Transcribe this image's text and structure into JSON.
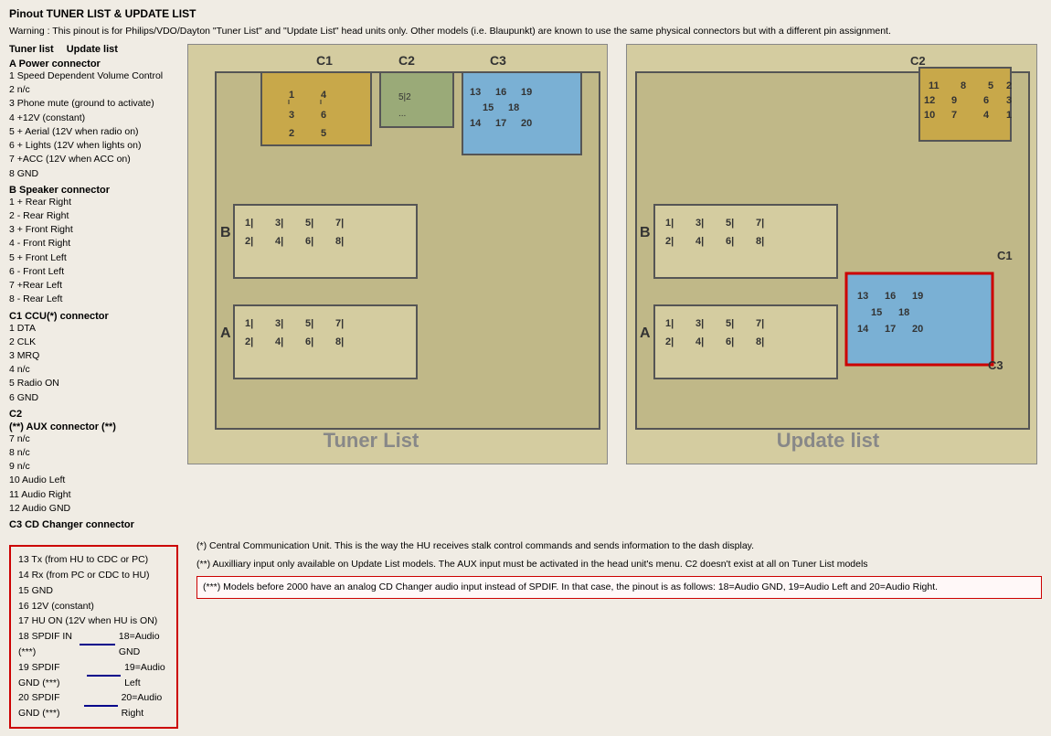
{
  "title": "Pinout TUNER LIST & UPDATE LIST",
  "warning": "Warning : This pinout is for Philips/VDO/Dayton \"Tuner List\" and \"Update List\" head units only. Other models (i.e. Blaupunkt) are known to use the same physical connectors but with a different pin assignment.",
  "list_headers": [
    "Tuner list",
    "Update list"
  ],
  "sections": {
    "A": {
      "label": "A Power connector",
      "items": [
        "1 Speed Dependent Volume Control",
        "2 n/c",
        "3 Phone mute (ground to activate)",
        "4 +12V (constant)",
        "5 + Aerial (12V when radio on)",
        "6 + Lights (12V when lights on)",
        "7 +ACC (12V when ACC on)",
        "8 GND"
      ]
    },
    "B": {
      "label": "B Speaker connector",
      "items": [
        "1 + Rear Right",
        "2 - Rear Right",
        "3 + Front Right",
        "4 - Front Right",
        "5 + Front Left",
        "6 - Front Left",
        "7 +Rear Left",
        "8 - Rear Left"
      ]
    },
    "C1": {
      "label": "C1 CCU(*) connector",
      "items": [
        "1 DTA",
        "2 CLK",
        "3 MRQ",
        "4 n/c",
        "5 Radio ON",
        "6 GND"
      ]
    },
    "C2": {
      "label": "C2",
      "items": []
    },
    "AUX": {
      "label": "(**) AUX connector (**)",
      "items": [
        "7 n/c",
        "8 n/c",
        "9 n/c",
        "10 Audio Left",
        "11 Audio Right",
        "12 Audio GND"
      ]
    },
    "C3": {
      "label": "C3 CD Changer connector",
      "items": []
    }
  },
  "cdc_items": [
    "13 Tx (from HU to CDC or PC)",
    "14 Rx (from PC or CDC to HU)",
    "15 GND",
    "16 12V (constant)",
    "17 HU ON (12V when HU is ON)",
    "18 SPDIF IN (***)",
    "19 SPDIF GND (***)",
    "20 SPDIF GND (***)"
  ],
  "audio_lines": [
    {
      "left": "18 SPDIF IN (***) ——",
      "right": "18=Audio GND"
    },
    {
      "left": "19 SPDIF GND (***) ——",
      "right": "19=Audio Left"
    },
    {
      "left": "20 SPDIF GND (***) ——",
      "right": "20=Audio Right"
    }
  ],
  "notes": {
    "ccu": "(*) Central Communication Unit. This is the way the HU receives stalk control commands and sends information to the dash display.",
    "aux": "(**) Auxilliary input only available on Update List models. The AUX input must be activated in the head unit's menu. C2 doesn't exist at all on Tuner List models",
    "spdif": "(***) Models before 2000 have an analog CD Changer audio input instead of SPDIF. In that case, the pinout is as follows: 18=Audio GND, 19=Audio Left and 20=Audio Right."
  },
  "diagram_labels": {
    "tuner": "Tuner List",
    "update": "Update list"
  },
  "colors": {
    "accent_red": "#cc0000",
    "connector_gold": "#c8a84a",
    "connector_blue": "#7ab0d4",
    "connector_green": "#8aaa6a",
    "outline_dark": "#444444",
    "bg_diagram": "#d8d0be",
    "pin_bg": "#c8c0a8"
  }
}
